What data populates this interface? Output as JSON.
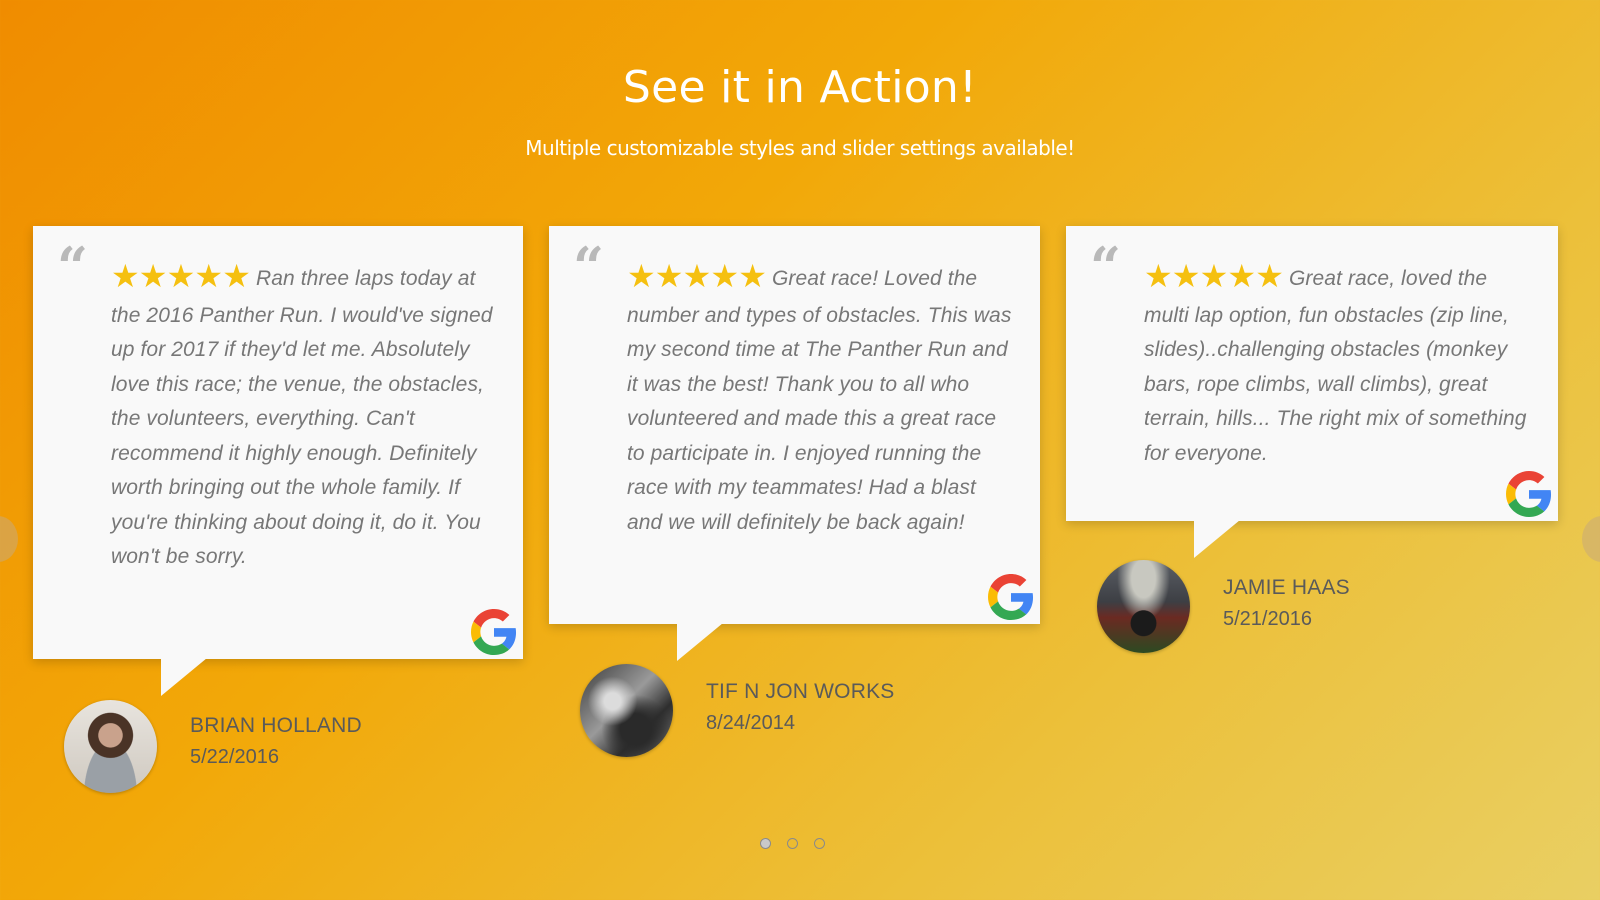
{
  "section": {
    "title": "See it in Action!",
    "subtitle": "Multiple customizable styles and slider settings available!"
  },
  "reviews": [
    {
      "stars": 5,
      "text": "Ran three laps today at the 2016 Panther Run. I would've signed up for 2017 if they'd let me. Absolutely love this race; the venue, the obstacles, the volunteers, everything. Can't recommend it highly enough. Definitely worth bringing out the whole family. If you're thinking about doing it, do it. You won't be sorry.",
      "author": "BRIAN HOLLAND",
      "date": "5/22/2016",
      "source_icon": "google-icon"
    },
    {
      "stars": 5,
      "text": "Great race! Loved the number and types of obstacles. This was my second time at The Panther Run and it was the best! Thank you to all who volunteered and made this a great race to participate in. I enjoyed running the race with my teammates! Had a blast and we will definitely be back again!",
      "author": "TIF N JON WORKS",
      "date": "8/24/2014",
      "source_icon": "google-icon"
    },
    {
      "stars": 5,
      "text": "Great race, loved the multi lap option, fun obstacles (zip line, slides)..challenging obstacles (monkey bars, rope climbs, wall climbs), great terrain, hills... The right mix of something for everyone.",
      "author": "JAMIE HAAS",
      "date": "5/21/2016",
      "source_icon": "google-icon"
    }
  ],
  "pagination": {
    "pages": 3,
    "active": 1
  },
  "colors": {
    "background_start": "#f08c00",
    "background_end": "#e9cf63",
    "star": "#f5c010",
    "card": "#f9f9f9",
    "review_text": "#777777"
  },
  "icons": {
    "quote": "quote-icon",
    "star": "star-icon",
    "source": "google-icon",
    "prev": "chevron-left-icon",
    "next": "chevron-right-icon"
  }
}
